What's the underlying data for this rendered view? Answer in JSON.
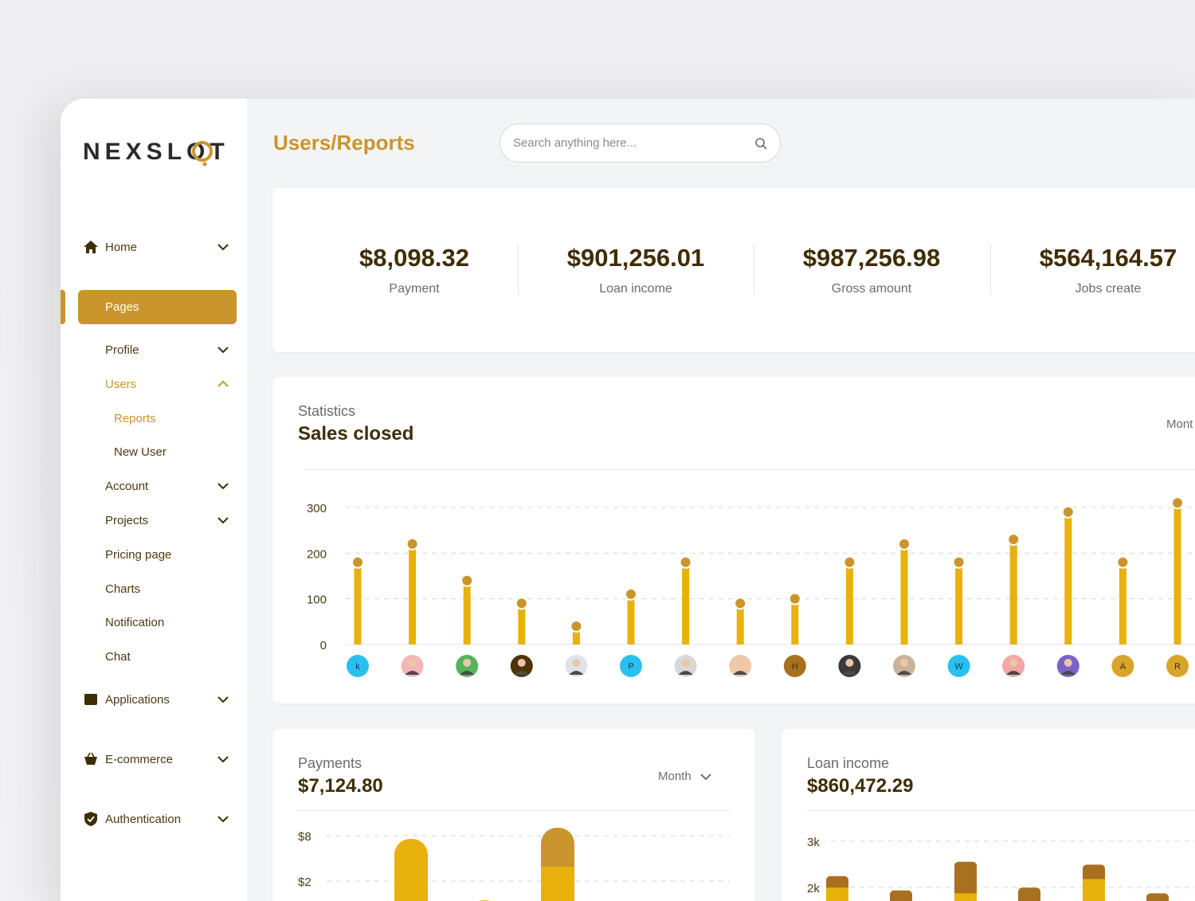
{
  "app": {
    "logo_text": "NEXSLOT"
  },
  "header": {
    "title": "Users/Reports",
    "search_placeholder": "Search anything here..."
  },
  "sidebar": {
    "home": "Home",
    "pages": "Pages",
    "profile": "Profile",
    "users": "Users",
    "reports": "Reports",
    "new_user": "New User",
    "account": "Account",
    "projects": "Projects",
    "pricing": "Pricing page",
    "charts": "Charts",
    "notification": "Notification",
    "chat": "Chat",
    "applications": "Applications",
    "ecommerce": "E-commerce",
    "authentication": "Authentication"
  },
  "stats": [
    {
      "value": "$8,098.32",
      "label": "Payment"
    },
    {
      "value": "$901,256.01",
      "label": "Loan income"
    },
    {
      "value": "$987,256.98",
      "label": "Gross amount"
    },
    {
      "value": "$564,164.57",
      "label": "Jobs create"
    }
  ],
  "sales": {
    "subtitle": "Statistics",
    "title": "Sales closed",
    "period": "Mont"
  },
  "payments": {
    "subtitle": "Payments",
    "amount": "$7,124.80",
    "period": "Month"
  },
  "loan": {
    "subtitle": "Loan income",
    "amount": "$860,472.29"
  },
  "colors": {
    "accent": "#c9952c",
    "bar_yellow": "#e8b10c",
    "bar_brown": "#a8701f",
    "text_dark": "#3f2d06"
  },
  "chart_data": [
    {
      "type": "bar",
      "title": "Sales closed",
      "subtitle": "Statistics",
      "categories": [
        "k",
        "u2",
        "u3",
        "u4",
        "u5",
        "P",
        "u7",
        "u8",
        "H",
        "u10",
        "u11",
        "W",
        "u13",
        "u14",
        "A",
        "R"
      ],
      "category_avatars": [
        {
          "letter": "k",
          "color": "#29c0ef"
        },
        {
          "letter": "",
          "color": "#f3b6b6"
        },
        {
          "letter": "",
          "color": "#56b35d"
        },
        {
          "letter": "",
          "color": "#4e3208"
        },
        {
          "letter": "",
          "color": "#dfe3ea"
        },
        {
          "letter": "P",
          "color": "#29c0ef"
        },
        {
          "letter": "",
          "color": "#d8d8d8"
        },
        {
          "letter": "",
          "color": "#f0c9a8"
        },
        {
          "letter": "H",
          "color": "#a8701f"
        },
        {
          "letter": "",
          "color": "#3a3a3a"
        },
        {
          "letter": "",
          "color": "#c9b49a"
        },
        {
          "letter": "W",
          "color": "#29c0ef"
        },
        {
          "letter": "",
          "color": "#f2a6a6"
        },
        {
          "letter": "",
          "color": "#7b62c9"
        },
        {
          "letter": "A",
          "color": "#d9a42a"
        },
        {
          "letter": "R",
          "color": "#d9a42a"
        }
      ],
      "values": [
        180,
        220,
        140,
        90,
        40,
        110,
        180,
        90,
        100,
        180,
        220,
        180,
        230,
        290,
        180,
        310
      ],
      "ylim": [
        0,
        300
      ],
      "yticks": [
        "0",
        "100",
        "200",
        "300"
      ],
      "grid": true
    },
    {
      "type": "bar",
      "title": "$7,124.80",
      "subtitle": "Payments",
      "yticks": [
        "$2",
        "$8"
      ],
      "series": [
        {
          "values": [
            3,
            12,
            5,
            7,
            3
          ]
        },
        {
          "values": [
            0,
            6,
            2,
            13,
            2
          ]
        }
      ]
    },
    {
      "type": "bar",
      "title": "$860,472.29",
      "subtitle": "Loan income",
      "yticks": [
        "2k",
        "3k"
      ],
      "series": [
        {
          "values": [
            1.8,
            0,
            1.6,
            0,
            2.1,
            0
          ]
        },
        {
          "values": [
            0.4,
            1.7,
            1.1,
            1.8,
            0.5,
            1.6
          ]
        }
      ]
    }
  ]
}
